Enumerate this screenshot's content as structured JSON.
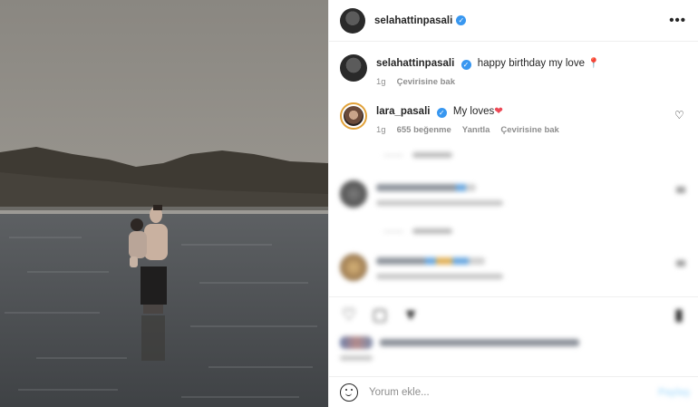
{
  "post": {
    "author": "selahattinpasali",
    "caption": "happy birthday my love",
    "caption_emoji": "📍",
    "caption_age": "1g",
    "see_translation": "Çevirisine bak"
  },
  "comments": [
    {
      "author": "lara_pasali",
      "text": "My loves",
      "emoji": "❤",
      "age": "1g",
      "likes": "655 beğenme",
      "reply": "Yanıtla",
      "see_translation": "Çevirisine bak"
    }
  ],
  "add_comment": {
    "placeholder": "Yorum ekle...",
    "post_label": "Paylaş"
  },
  "icons": {
    "more": "more-options-icon",
    "verified": "verified-badge-icon",
    "like": "heart-icon",
    "comment": "comment-icon",
    "share": "share-icon",
    "save": "bookmark-icon",
    "emoji": "emoji-smile-icon"
  },
  "colors": {
    "accent": "#3897f0",
    "heart": "#ed4956",
    "post_disabled": "#b2dffc"
  }
}
